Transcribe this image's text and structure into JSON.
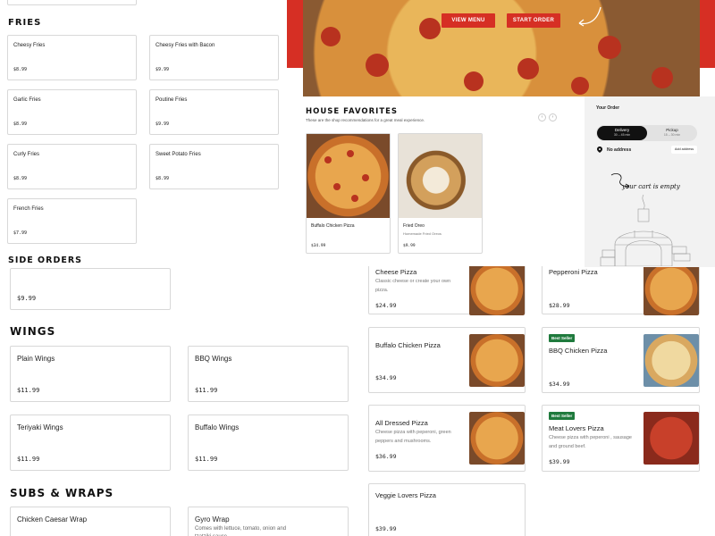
{
  "fries": {
    "title": "FRIES",
    "items": [
      {
        "name": "Cheesy Fries",
        "price": "$8.99"
      },
      {
        "name": "Cheesy Fries with Bacon",
        "price": "$9.99"
      },
      {
        "name": "Garlic Fries",
        "price": "$8.99"
      },
      {
        "name": "Poutine Fries",
        "price": "$9.99"
      },
      {
        "name": "Curly Fries",
        "price": "$8.99"
      },
      {
        "name": "Sweet Potato Fries",
        "price": "$8.99"
      },
      {
        "name": "French Fries",
        "price": "$7.99"
      }
    ]
  },
  "side_orders": {
    "title": "SIDE ORDERS",
    "items": [
      {
        "price": "$9.99"
      }
    ]
  },
  "wings": {
    "title": "WINGS",
    "items": [
      {
        "name": "Plain Wings",
        "price": "$11.99"
      },
      {
        "name": "BBQ Wings",
        "price": "$11.99"
      },
      {
        "name": "Teriyaki Wings",
        "price": "$11.99"
      },
      {
        "name": "Buffalo Wings",
        "price": "$11.99"
      }
    ]
  },
  "subs": {
    "title": "SUBS & WRAPS",
    "items": [
      {
        "name": "Chicken Caesar Wrap"
      },
      {
        "name": "Gyro Wrap",
        "desc": "Comes with lettuce, tomato, onion and tzatziki sauce."
      }
    ]
  },
  "hero": {
    "view_menu": "VIEW MENU",
    "start_order": "START ORDER"
  },
  "favorites": {
    "title": "HOUSE FAVORITES",
    "subtitle": "These are the shop recommendations for a great meal experience.",
    "items": [
      {
        "name": "Buffalo Chicken Pizza",
        "sub": "",
        "price": "$34.99"
      },
      {
        "name": "Fried Oreo",
        "sub": "Homemade Fried Oreos",
        "price": "$9.99"
      }
    ]
  },
  "order": {
    "title": "Your Order",
    "delivery_label": "Delivery",
    "delivery_time": "30 – 45 min",
    "pickup_label": "Pickup",
    "pickup_time": "15 – 30 min",
    "no_address": "No address",
    "add_address": "Add address",
    "empty_note": "your cart is empty"
  },
  "pizzas": [
    {
      "name": "Cheese Pizza",
      "desc": "Classic cheese or create your own pizza.",
      "price": "$24.99",
      "badge": ""
    },
    {
      "name": "Pepperoni Pizza",
      "desc": "",
      "price": "$28.99",
      "badge": ""
    },
    {
      "name": "Buffalo Chicken Pizza",
      "desc": "",
      "price": "$34.99",
      "badge": ""
    },
    {
      "name": "BBQ Chicken Pizza",
      "desc": "",
      "price": "$34.99",
      "badge": "Best Seller"
    },
    {
      "name": "All Dressed Pizza",
      "desc": "Cheese pizza with peperoni, green peppers and mushrooms.",
      "price": "$36.99",
      "badge": ""
    },
    {
      "name": "Meat Lovers Pizza",
      "desc": "Cheese pizza with peperoni , sausage and ground beef.",
      "price": "$39.99",
      "badge": "Best Seller"
    },
    {
      "name": "Veggie Lovers Pizza",
      "desc": "",
      "price": "$39.99",
      "badge": ""
    }
  ],
  "colors": {
    "accent": "#d62f24",
    "badge": "#1f7a3d"
  }
}
